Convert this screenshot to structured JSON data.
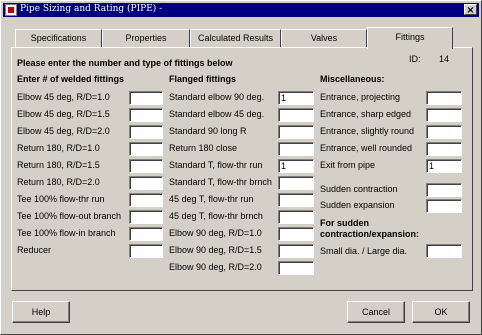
{
  "window": {
    "title": "Pipe Sizing and Rating (PIPE) -",
    "close_symbol": "×",
    "app_icon": "pipe-app-icon"
  },
  "tabs": [
    {
      "label": "Specifications"
    },
    {
      "label": "Properties"
    },
    {
      "label": "Calculated Results"
    },
    {
      "label": "Valves"
    },
    {
      "label": "Fittings",
      "active": true
    }
  ],
  "panel": {
    "instruction": "Please enter the number and type of fittings below",
    "id_label": "ID:",
    "id_value": "14"
  },
  "welded": {
    "header": "Enter # of welded fittings",
    "items": [
      {
        "label": "Elbow 45 deg, R/D=1.0",
        "value": ""
      },
      {
        "label": "Elbow 45 deg, R/D=1.5",
        "value": ""
      },
      {
        "label": "Elbow 45 deg, R/D=2.0",
        "value": ""
      },
      {
        "label": "Return 180, R/D=1.0",
        "value": ""
      },
      {
        "label": "Return 180, R/D=1.5",
        "value": ""
      },
      {
        "label": "Return 180, R/D=2.0",
        "value": ""
      },
      {
        "label": "Tee 100% flow-thr run",
        "value": ""
      },
      {
        "label": "Tee 100% flow-out branch",
        "value": ""
      },
      {
        "label": "Tee 100% flow-in branch",
        "value": ""
      },
      {
        "label": "Reducer",
        "value": ""
      }
    ]
  },
  "flanged": {
    "header": "Flanged fittings",
    "items": [
      {
        "label": "Standard elbow 90 deg.",
        "value": "1"
      },
      {
        "label": "Standard elbow 45 deg.",
        "value": ""
      },
      {
        "label": "Standard 90 long R",
        "value": ""
      },
      {
        "label": "Return 180 close",
        "value": ""
      },
      {
        "label": "Standard T, flow-thr run",
        "value": "1"
      },
      {
        "label": "Standard T, flow-thr brnch",
        "value": ""
      },
      {
        "label": "45 deg T, flow-thr run",
        "value": ""
      },
      {
        "label": "45 deg T, flow-thr brnch",
        "value": ""
      },
      {
        "label": "Elbow 90 deg, R/D=1.0",
        "value": ""
      },
      {
        "label": "Elbow 90 deg, R/D=1.5",
        "value": ""
      },
      {
        "label": "Elbow 90 deg, R/D=2.0",
        "value": ""
      }
    ]
  },
  "misc": {
    "header": "Miscellaneous:",
    "items": [
      {
        "label": "Entrance,  projecting",
        "value": ""
      },
      {
        "label": "Entrance, sharp edged",
        "value": ""
      },
      {
        "label": "Entrance, slightly round",
        "value": ""
      },
      {
        "label": "Entrance, well rounded",
        "value": ""
      },
      {
        "label": "Exit from pipe",
        "value": "1"
      }
    ],
    "sudden_contraction": {
      "label": "Sudden contraction",
      "value": ""
    },
    "sudden_expansion": {
      "label": "Sudden expansion",
      "value": ""
    },
    "sudden_header_line1": "For sudden",
    "sudden_header_line2": "contraction/expansion:",
    "ratio": {
      "label": "Small dia. / Large dia.",
      "value": ""
    }
  },
  "buttons": {
    "help": "Help",
    "cancel": "Cancel",
    "ok": "OK"
  }
}
